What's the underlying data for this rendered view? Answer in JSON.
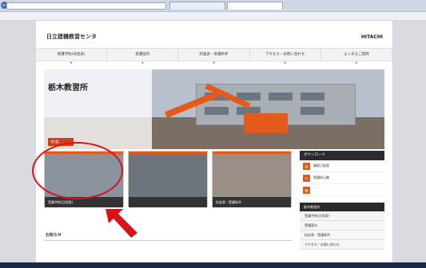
{
  "browser": {
    "bookmarks": "",
    "back_label": "←"
  },
  "site": {
    "brand": "日立建機教習センタ",
    "logo": "HITACHI"
  },
  "nav": {
    "items": [
      {
        "label": "受講予約(日程表)"
      },
      {
        "label": "受講案内"
      },
      {
        "label": "料金表・受講条件"
      },
      {
        "label": "アクセス・お問い合わせ"
      },
      {
        "label": "よくあるご質問"
      }
    ]
  },
  "breadcrumb": "",
  "hero": {
    "org": "",
    "title": "栃木教習所",
    "address": "",
    "map_button": "地 図"
  },
  "cards": [
    {
      "caption": "受講予約(日程表)"
    },
    {
      "caption": ""
    },
    {
      "caption": "料金表・受講条件"
    }
  ],
  "sidebar": {
    "download_title": "ダウンロード",
    "downloads": [
      {
        "label": "講習日程表",
        "icon": "document-icon"
      },
      {
        "label": "受講申込書",
        "icon": "form-icon"
      },
      {
        "label": "",
        "icon": "guide-icon"
      }
    ],
    "section_title": "栃木教習所",
    "links": [
      {
        "label": "受講予約(日程表)"
      },
      {
        "label": "受講案内"
      },
      {
        "label": "料金表・受講条件"
      },
      {
        "label": "アクセス・お問い合わせ"
      }
    ]
  },
  "news": {
    "title": "お知らせ",
    "items": [
      {
        "date": "",
        "text": ""
      }
    ]
  },
  "colors": {
    "accent": "#e35a1a",
    "annotation": "#d8141a",
    "dark": "#2b2b2b"
  }
}
